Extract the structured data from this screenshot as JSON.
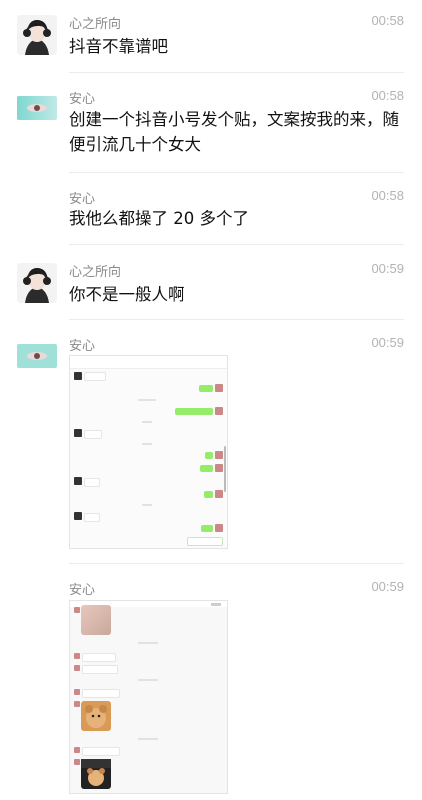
{
  "messages": [
    {
      "sender": "心之所向",
      "time": "00:58",
      "text": "抖音不靠谱吧",
      "avatar": "anime-headphones-avatar"
    },
    {
      "sender": "安心",
      "time": "00:58",
      "text": "创建一个抖音小号发个贴，文案按我的来，随便引流几十个女大",
      "avatar": "teal-eye-avatar"
    },
    {
      "sender": "安心",
      "time": "00:58",
      "text": "我他么都操了 20 多个了"
    },
    {
      "sender": "心之所向",
      "time": "00:59",
      "text": "你不是一般人啊",
      "avatar": "anime-headphones-avatar"
    },
    {
      "sender": "安心",
      "time": "00:59",
      "type": "image",
      "image_desc": "chat-screenshot-1",
      "avatar": "teal-eye-avatar"
    },
    {
      "sender": "安心",
      "time": "00:59",
      "type": "image",
      "image_desc": "chat-screenshot-2"
    }
  ],
  "colors": {
    "bubble_green": "#95ec69",
    "name_gray": "#8a8a8a",
    "time_gray": "#b3b3b3"
  }
}
